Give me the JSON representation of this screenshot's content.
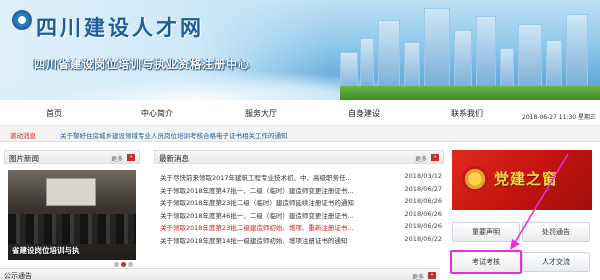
{
  "site": {
    "title": "四川建设人才网",
    "subtitle": "四川省建设岗位培训与执业资格注册中心"
  },
  "nav": {
    "items": [
      "首页",
      "中心简介",
      "服务大厅",
      "自身建设",
      "联系我们"
    ],
    "date": "2018-06-27 11:30 星期三"
  },
  "ticker": {
    "label": "滚动消息",
    "text": "关于黎好住房城乡建设领域专业人员岗位培训考核合格电子证书相关工作的通知"
  },
  "photo_news": {
    "heading": "图片新闻",
    "more": "更多",
    "more_icon": "»",
    "caption": "省建设岗位培训与执",
    "active_dot": 1
  },
  "latest_news": {
    "heading": "最新消息",
    "more": "更多",
    "more_icon": "»",
    "items": [
      {
        "title": "关于尽快前来领取2017年建筑工程专业技术初、中、高级职务任...",
        "date": "2018/03/12",
        "highlight": false
      },
      {
        "title": "关于领取2018年度第47批一、二级（临时）建造师变更注册证书...",
        "date": "2018/06/27",
        "highlight": false
      },
      {
        "title": "关于领取2018年度第23批二级（临时）建造师延续注册证书的通知",
        "date": "2018/06/26",
        "highlight": false
      },
      {
        "title": "关于领取2018年度第46批一、二级（临时）建造师变更注册证书...",
        "date": "2018/06/26",
        "highlight": false
      },
      {
        "title": "关于领取2018年度第23批二级建造师初始、增项、重新注册证书...",
        "date": "2018/06/26",
        "highlight": true
      },
      {
        "title": "关于领取2018年度第14批一级建造师初始、增项注册证书的通知",
        "date": "2018/06/22",
        "highlight": false
      }
    ]
  },
  "notice": {
    "heading": "公示通告",
    "more": "更多",
    "more_icon": "»"
  },
  "side": {
    "party_banner": "党建之窗",
    "buttons": {
      "reputation": "重要声明",
      "penalty": "处罚通告",
      "exam": "考试考核",
      "talent": "人才交流"
    }
  },
  "colors": {
    "brand_blue": "#1f5c9a",
    "alert_red": "#d02020",
    "highlight_magenta": "#e42fe0"
  }
}
